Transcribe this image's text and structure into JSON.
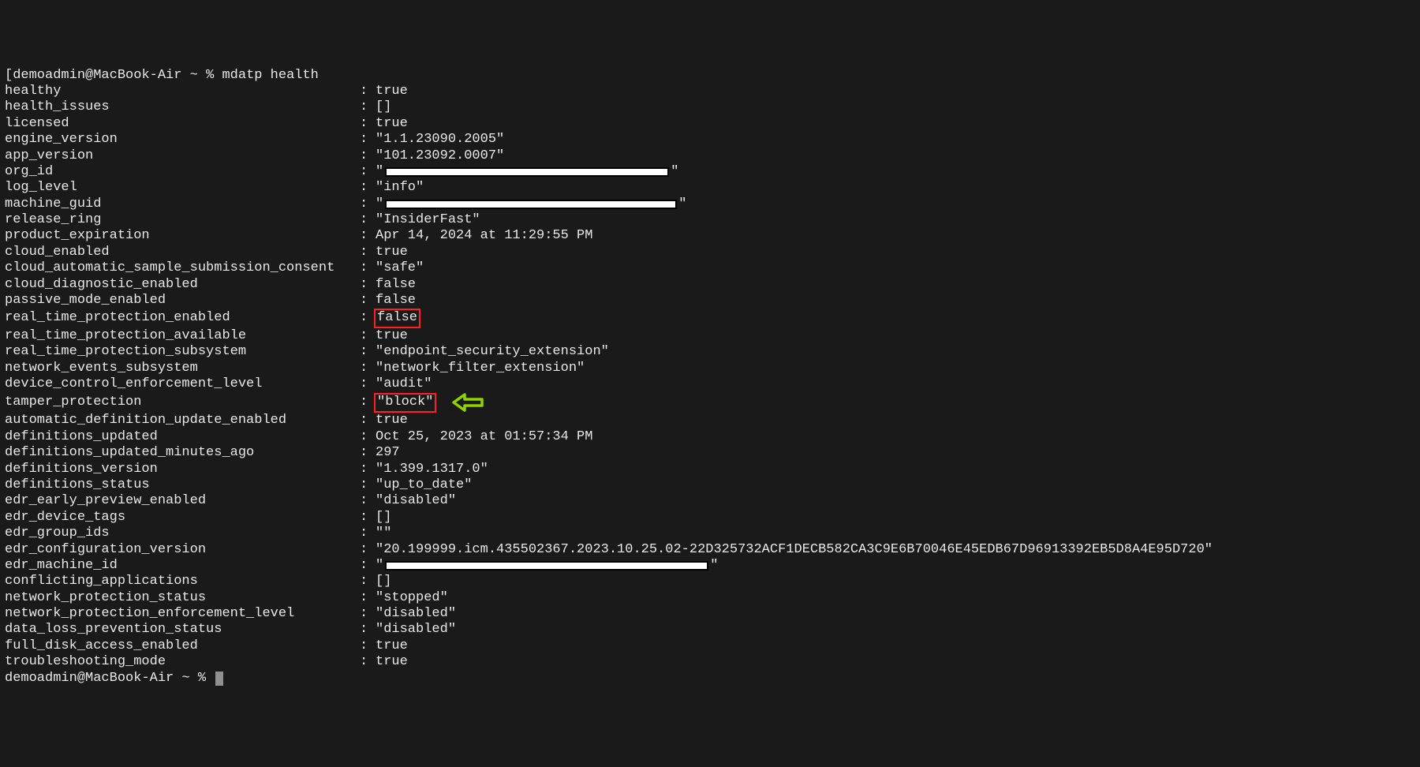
{
  "prompt1_user": "demoadmin",
  "prompt1_host": "MacBook-Air",
  "prompt1_sym": " ~ % ",
  "command": "mdatp health",
  "prompt2_user": "demoadmin",
  "prompt2_host": "MacBook-Air",
  "prompt2_sym": " ~ % ",
  "colon": ": ",
  "rows": [
    {
      "k": "healthy",
      "v": "true"
    },
    {
      "k": "health_issues",
      "v": "[]"
    },
    {
      "k": "licensed",
      "v": "true"
    },
    {
      "k": "engine_version",
      "v": "\"1.1.23090.2005\""
    },
    {
      "k": "app_version",
      "v": "\"101.23092.0007\""
    },
    {
      "k": "org_id",
      "pre": "\"",
      "redact": 360,
      "post": "\""
    },
    {
      "k": "log_level",
      "v": "\"info\""
    },
    {
      "k": "machine_guid",
      "pre": "\"",
      "redact": 370,
      "post": "\""
    },
    {
      "k": "release_ring",
      "v": "\"InsiderFast\""
    },
    {
      "k": "product_expiration",
      "v": "Apr 14, 2024 at 11:29:55 PM"
    },
    {
      "k": "cloud_enabled",
      "v": "true"
    },
    {
      "k": "cloud_automatic_sample_submission_consent",
      "v": "\"safe\""
    },
    {
      "k": "cloud_diagnostic_enabled",
      "v": "false"
    },
    {
      "k": "passive_mode_enabled",
      "v": "false"
    },
    {
      "k": "real_time_protection_enabled",
      "v": "false",
      "highlight": "red"
    },
    {
      "k": "real_time_protection_available",
      "v": "true"
    },
    {
      "k": "real_time_protection_subsystem",
      "v": "\"endpoint_security_extension\""
    },
    {
      "k": "network_events_subsystem",
      "v": "\"network_filter_extension\""
    },
    {
      "k": "device_control_enforcement_level",
      "v": "\"audit\""
    },
    {
      "k": "tamper_protection",
      "v": "\"block\"",
      "highlight": "red",
      "arrow": true
    },
    {
      "k": "automatic_definition_update_enabled",
      "v": "true"
    },
    {
      "k": "definitions_updated",
      "v": "Oct 25, 2023 at 01:57:34 PM"
    },
    {
      "k": "definitions_updated_minutes_ago",
      "v": "297"
    },
    {
      "k": "definitions_version",
      "v": "\"1.399.1317.0\""
    },
    {
      "k": "definitions_status",
      "v": "\"up_to_date\""
    },
    {
      "k": "edr_early_preview_enabled",
      "v": "\"disabled\""
    },
    {
      "k": "edr_device_tags",
      "v": "[]"
    },
    {
      "k": "edr_group_ids",
      "v": "\"\""
    },
    {
      "k": "edr_configuration_version",
      "v": "\"20.199999.icm.435502367.2023.10.25.02-22D325732ACF1DECB582CA3C9E6B70046E45EDB67D96913392EB5D8A4E95D720\""
    },
    {
      "k": "edr_machine_id",
      "pre": "\"",
      "redact": 410,
      "post": "\""
    },
    {
      "k": "conflicting_applications",
      "v": "[]"
    },
    {
      "k": "network_protection_status",
      "v": "\"stopped\""
    },
    {
      "k": "network_protection_enforcement_level",
      "v": "\"disabled\""
    },
    {
      "k": "data_loss_prevention_status",
      "v": "\"disabled\""
    },
    {
      "k": "full_disk_access_enabled",
      "v": "true"
    },
    {
      "k": "troubleshooting_mode",
      "v": "true"
    }
  ]
}
